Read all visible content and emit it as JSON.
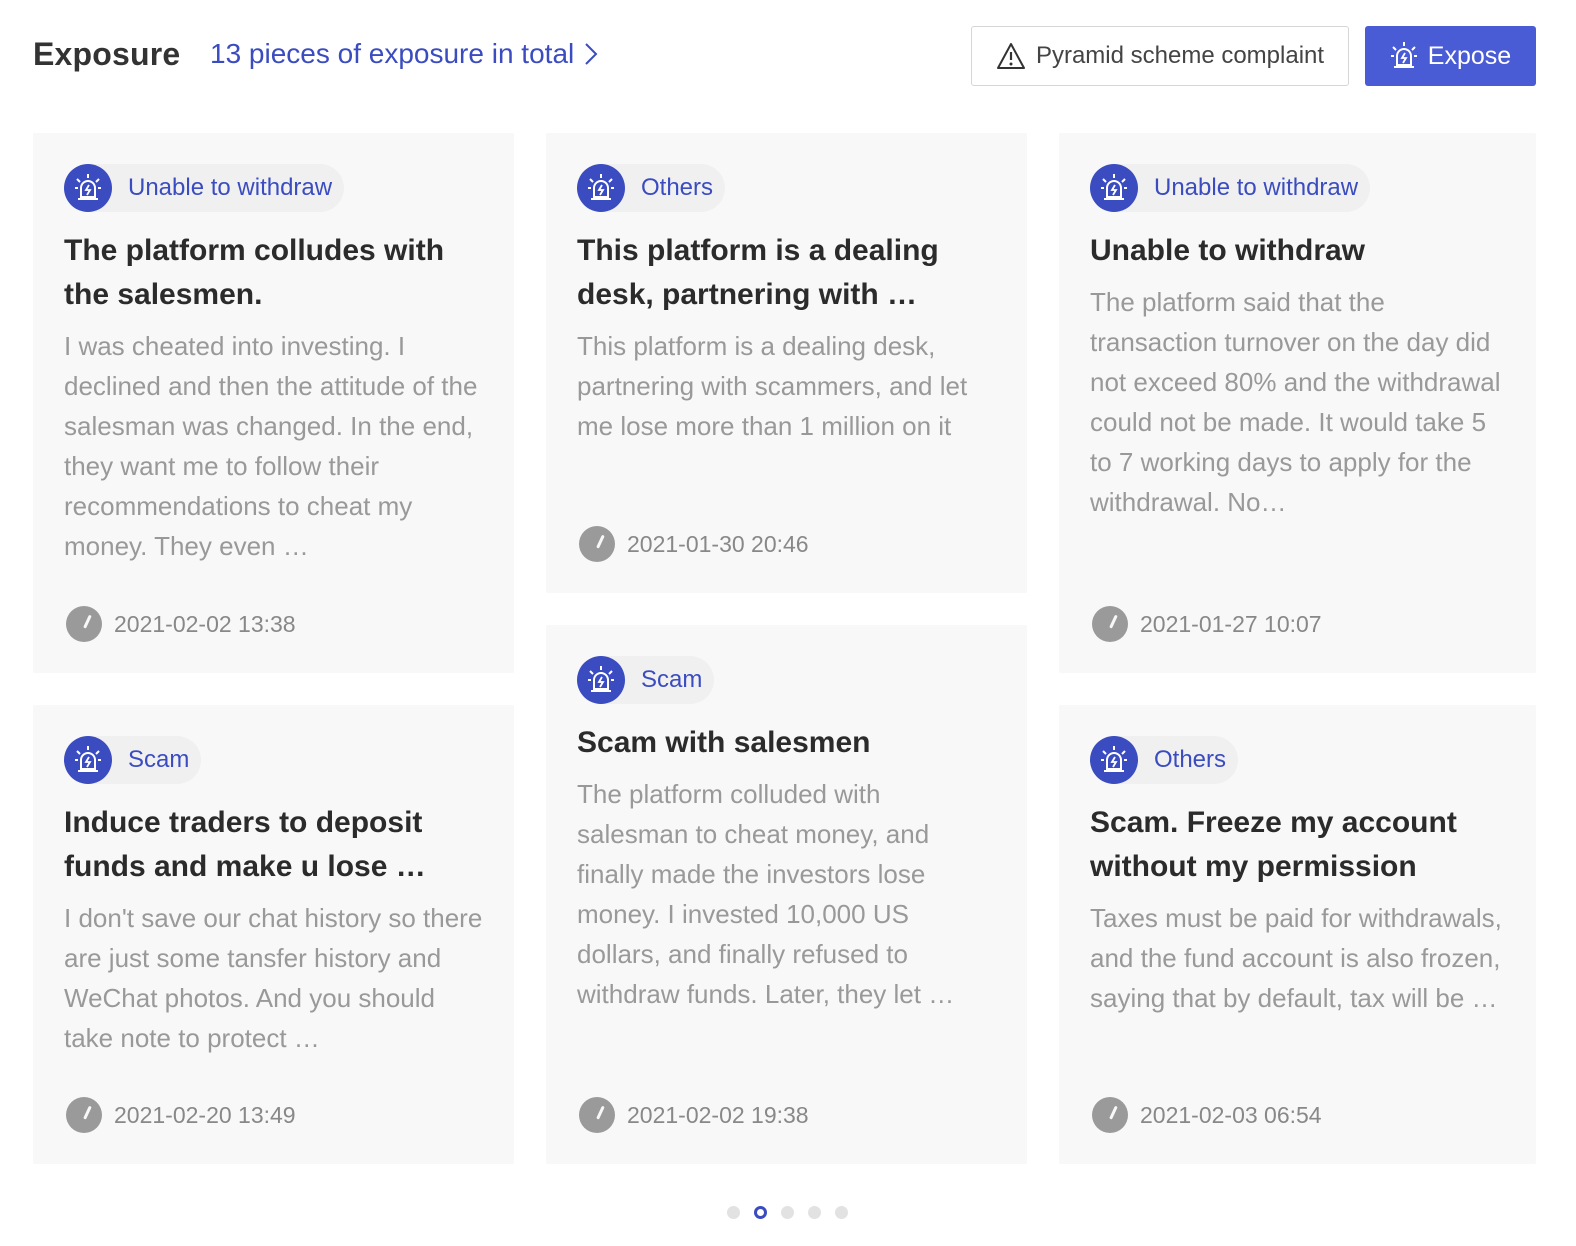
{
  "header": {
    "title": "Exposure",
    "total_link": "13 pieces of exposure in total",
    "complaint_button": "Pyramid scheme complaint",
    "expose_button": "Expose"
  },
  "colors": {
    "accent": "#3a4cc0",
    "button": "#4a5bd6",
    "card_bg": "#f8f8f8"
  },
  "cards": [
    {
      "tag": "Unable to withdraw",
      "title": "The platform colludes with the salesmen.",
      "body": "I was cheated into investing. I declined and then the attitude of the salesman was changed. In the end, they want me to follow their recommendations to cheat my money. They even …",
      "time": "2021-02-02 13:38"
    },
    {
      "tag": "Others",
      "title": "This platform is a dealing desk, partnering with …",
      "body": "This platform is a dealing desk, partnering with scammers, and let me lose more than 1 million on it",
      "time": "2021-01-30 20:46"
    },
    {
      "tag": "Unable to withdraw",
      "title": "Unable to withdraw",
      "body": "The platform said that the transaction turnover on the day did not exceed 80% and the withdrawal could not be made. It would take 5 to 7 working days to apply for the withdrawal. No…",
      "time": "2021-01-27 10:07"
    },
    {
      "tag": "Scam",
      "title": "Induce traders to deposit funds and make u lose …",
      "body": "I don't save our chat history so there are just some tansfer history and WeChat photos. And you should take note to protect …",
      "time": "2021-02-20 13:49"
    },
    {
      "tag": "Scam",
      "title": "Scam with salesmen",
      "body": "The platform colluded with salesman to cheat money, and finally made the investors lose money. I invested 10,000 US dollars, and finally refused to withdraw funds. Later, they let …",
      "time": "2021-02-02 19:38"
    },
    {
      "tag": "Others",
      "title": "Scam. Freeze my account without my permission",
      "body": "Taxes must be paid for withdrawals, and the fund account is also frozen, saying that by default, tax will be …",
      "time": "2021-02-03 06:54"
    }
  ],
  "pagination": {
    "pages": 5,
    "active_page": 2
  }
}
